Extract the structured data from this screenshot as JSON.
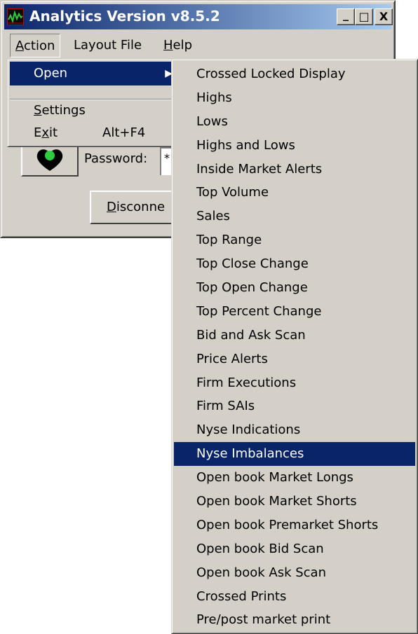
{
  "window": {
    "title": "Analytics Version v8.5.2",
    "minimize_glyph": "_",
    "maximize_glyph": "□",
    "close_glyph": "X"
  },
  "menubar": {
    "items": [
      {
        "label": "Action",
        "mnemonic": "A",
        "rest": "ction"
      },
      {
        "label": "Layout File"
      },
      {
        "label": "Help",
        "mnemonic": "H",
        "rest": "elp"
      }
    ]
  },
  "action_menu": {
    "open": {
      "label": "Open",
      "arrow": "▶"
    },
    "settings": {
      "label": "Settings",
      "mnemonic": "S",
      "rest": "ettings"
    },
    "exit": {
      "label": "Exit",
      "pre": "E",
      "mnemonic": "x",
      "rest": "it",
      "shortcut": "Alt+F4"
    }
  },
  "background": {
    "password_label": "Password:",
    "password_value": "*",
    "disconnect_label": "Disconnect",
    "disconnect_mnemonic": "D",
    "disconnect_rest": "isconne"
  },
  "open_submenu": {
    "items": [
      "Crossed Locked Display",
      "Highs",
      "Lows",
      "Highs and Lows",
      "Inside Market Alerts",
      "Top Volume",
      "Sales",
      "Top Range",
      "Top Close Change",
      "Top Open Change",
      "Top Percent Change",
      "Bid and Ask Scan",
      "Price Alerts",
      "Firm Executions",
      "Firm SAIs",
      "Nyse Indications",
      "Nyse Imbalances",
      "Open book Market Longs",
      "Open book Market Shorts",
      "Open book Premarket Shorts",
      "Open book Bid Scan",
      "Open book Ask Scan",
      "Crossed Prints",
      "Pre/post market print"
    ],
    "highlighted": "Nyse Imbalances"
  },
  "colors": {
    "title_start": "#0a246a",
    "title_end": "#a6caf0",
    "highlight": "#0a246a",
    "face": "#d4d0c8"
  }
}
